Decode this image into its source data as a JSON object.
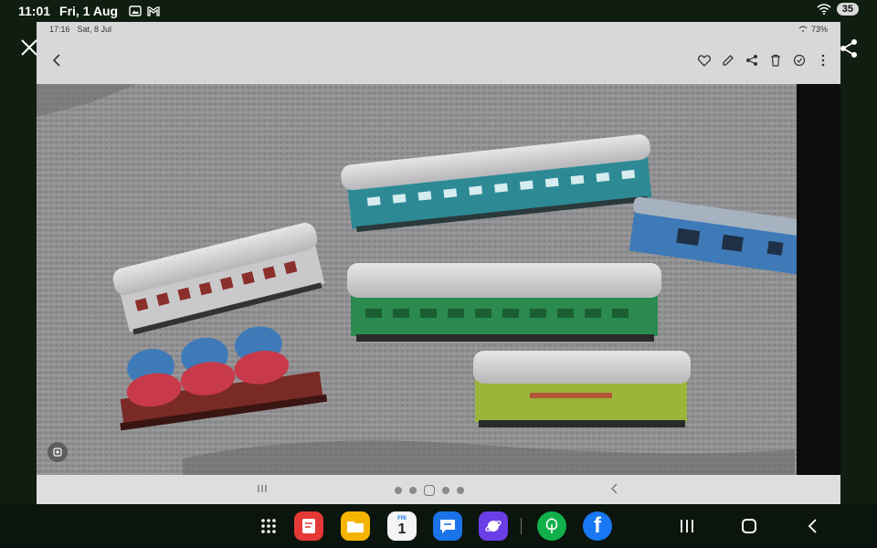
{
  "device_status": {
    "time": "11:01",
    "date": "Fri, 1 Aug",
    "badge": "35",
    "icons": [
      "gallery-icon",
      "gmail-icon",
      "wifi-icon"
    ]
  },
  "inner_status": {
    "time": "17:16",
    "date": "Sat, 8 Jul",
    "battery": "73%"
  },
  "viewer_toolbar": {
    "actions": [
      "favourite-icon",
      "edit-icon",
      "share-icon",
      "delete-icon",
      "remaster-icon",
      "more-icon"
    ]
  },
  "photo": {
    "subject": "model railway carriages on grey carpet",
    "colors": {
      "carpet": "#8e8e90",
      "teal": "#2d8a95",
      "green": "#2b8a4e",
      "lime": "#9ab53a",
      "maroon": "#7a2a25",
      "blue": "#3f7ab8",
      "red": "#c8394a"
    }
  },
  "taskbar": {
    "apps": [
      "app-drawer-icon",
      "notes-app-icon",
      "files-app-icon",
      "calendar-app-icon",
      "messages-app-icon",
      "browser-app-icon",
      "plant-app-icon",
      "facebook-app-icon"
    ],
    "calendar_day": "FRI",
    "calendar_date": "1",
    "facebook_letter": "f"
  },
  "colors": {
    "frame_bar": "#d8d8da",
    "background": "#101d11"
  }
}
